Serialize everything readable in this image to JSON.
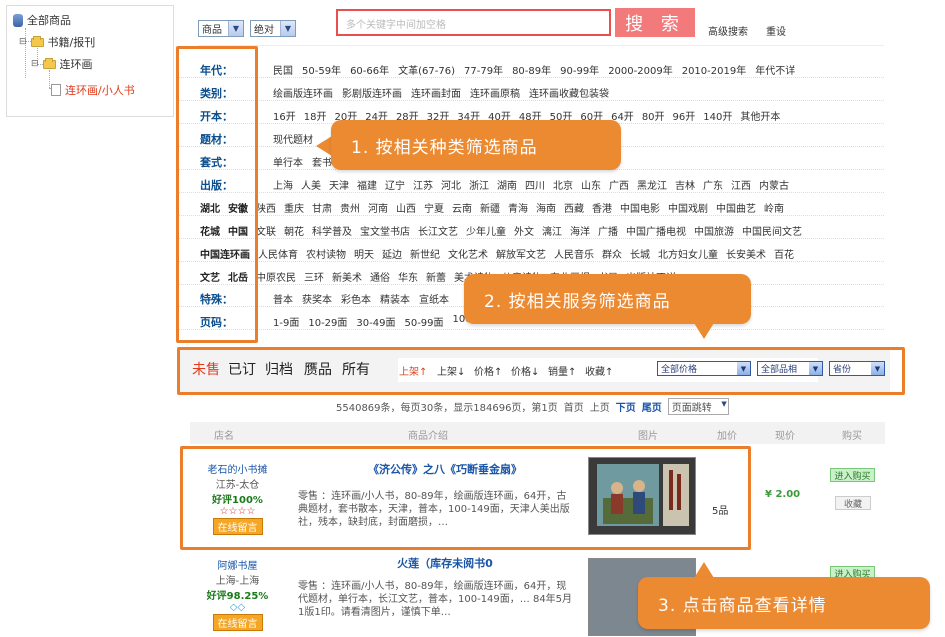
{
  "tree": {
    "root": "全部商品",
    "level1": "书籍/报刊",
    "level2": "连环画",
    "level3": "连环画/小人书"
  },
  "search": {
    "scope": "商品",
    "match": "绝对",
    "placeholder": "多个关键字中间加空格",
    "button": "搜 索",
    "advanced": "高级搜索",
    "reset": "重设"
  },
  "filters": {
    "era": {
      "label": "年代：",
      "options": [
        "民国",
        "50-59年",
        "60-66年",
        "文革(67-76)",
        "77-79年",
        "80-89年",
        "90-99年",
        "2000-2009年",
        "2010-2019年",
        "年代不详"
      ]
    },
    "category": {
      "label": "类别：",
      "options": [
        "绘画版连环画",
        "影剧版连环画",
        "连环画封面",
        "连环画原稿",
        "连环画收藏包装袋"
      ]
    },
    "format": {
      "label": "开本：",
      "options": [
        "16开",
        "18开",
        "20开",
        "24开",
        "28开",
        "32开",
        "34开",
        "40开",
        "48开",
        "50开",
        "60开",
        "64开",
        "80开",
        "96开",
        "140开",
        "其他开本"
      ]
    },
    "theme": {
      "label": "题材：",
      "options": [
        "现代题材"
      ]
    },
    "set": {
      "label": "套式：",
      "options": [
        "单行本",
        "套书"
      ]
    },
    "publisher": {
      "label": "出版：",
      "row1": [
        "上海",
        "人美",
        "天津",
        "福建",
        "辽宁",
        "江苏",
        "河北",
        "浙江",
        "湖南",
        "四川",
        "北京",
        "山东",
        "广西",
        "黑龙江",
        "吉林",
        "广东",
        "江西",
        "内蒙古"
      ],
      "row2_bold": [
        "湖北",
        "安徽"
      ],
      "row2": [
        "陕西",
        "重庆",
        "甘肃",
        "贵州",
        "河南",
        "山西",
        "宁夏",
        "云南",
        "新疆",
        "青海",
        "海南",
        "西藏",
        "香港",
        "中国电影",
        "中国戏剧",
        "中国曲艺",
        "岭南"
      ],
      "row3_bold": [
        "花城",
        "中国"
      ],
      "row3": [
        "文联",
        "朝花",
        "科学普及",
        "宝文堂书店",
        "长江文艺",
        "少年儿童",
        "外文",
        "漓江",
        "海洋",
        "广播",
        "中国广播电视",
        "中国旅游",
        "中国民间文艺"
      ],
      "row4_bold": [
        "中国连环画"
      ],
      "row4": [
        "人民体育",
        "农村读物",
        "明天",
        "延边",
        "新世纪",
        "文化艺术",
        "解放军文艺",
        "人民音乐",
        "群众",
        "长城",
        "北方妇女儿童",
        "长安美术",
        "百花"
      ],
      "row5_bold": [
        "文艺",
        "北岳"
      ],
      "row5": [
        "文艺",
        "中原农民",
        "三环",
        "新美术",
        "通俗",
        "华东",
        "新蕾",
        "美术读物",
        "儿童读物",
        "东北画报",
        "书局",
        "出版社不详"
      ]
    },
    "special": {
      "label": "特殊：",
      "options": [
        "普本",
        "获奖本",
        "彩色本",
        "精装本",
        "宣纸本"
      ]
    },
    "pages": {
      "label": "页码：",
      "options": [
        "1-9面",
        "10-29面",
        "30-49面",
        "50-99面",
        "100"
      ]
    }
  },
  "tabs": [
    "未售",
    "已订",
    "归档",
    "赝品",
    "所有"
  ],
  "sort": [
    "上架↑",
    "上架↓",
    "价格↑",
    "价格↓",
    "销量↑",
    "收藏↑"
  ],
  "dropdowns": {
    "price": "全部价格",
    "quality": "全部品相",
    "province": "省份"
  },
  "pager": {
    "summary": "5540869条，每页30条，显示184696页，第1页",
    "first": "首页",
    "prev": "上页",
    "next": "下页",
    "last": "尾页",
    "jump": "页面跳转"
  },
  "table_headers": [
    "店名",
    "商品介绍",
    "图片",
    "加价",
    "现价",
    "购买"
  ],
  "products": [
    {
      "shop": "老石的小书摊",
      "location": "江苏-太仓",
      "rating": "好评100%",
      "stars": "☆☆☆☆",
      "message": "在线留言",
      "title": "《济公传》之八《巧断垂金扇》",
      "desc": "零售 ：连环画/小人书，80-89年，绘画版连环画，64开，古典题材，套书散本，天津，普本，100-149面，天津人美出版社，残本，缺封底，封面磨损，…",
      "condition": "5品",
      "price": "¥ 2.00",
      "buy": "进入购买",
      "fav": "收藏"
    },
    {
      "shop": "阿娜书屋",
      "location": "上海-上海",
      "rating": "好评98.25%",
      "stars": "◇◇",
      "message": "在线留言",
      "title": "火莲（库存未阅书0",
      "desc": "零售 ：连环画/小人书，80-89年，绘画版连环画，64开，现代题材，单行本，长江文艺，普本，100-149面，… 84年5月1版1印。请看清图片，谨慎下单…",
      "condition": "",
      "price": "",
      "buy": "进入购买",
      "fav": ""
    }
  ],
  "callouts": {
    "c1": "1. 按相关种类筛选商品",
    "c2": "2. 按相关服务筛选商品",
    "c3": "3. 点击商品查看详情"
  },
  "colors": {
    "accent": "#ec7e2b",
    "link": "#1a55a8",
    "active": "#e03a1c",
    "searchRed": "#e8504f"
  },
  "icons": {
    "db": "database-icon",
    "folder": "folder-icon",
    "doc": "document-icon"
  }
}
